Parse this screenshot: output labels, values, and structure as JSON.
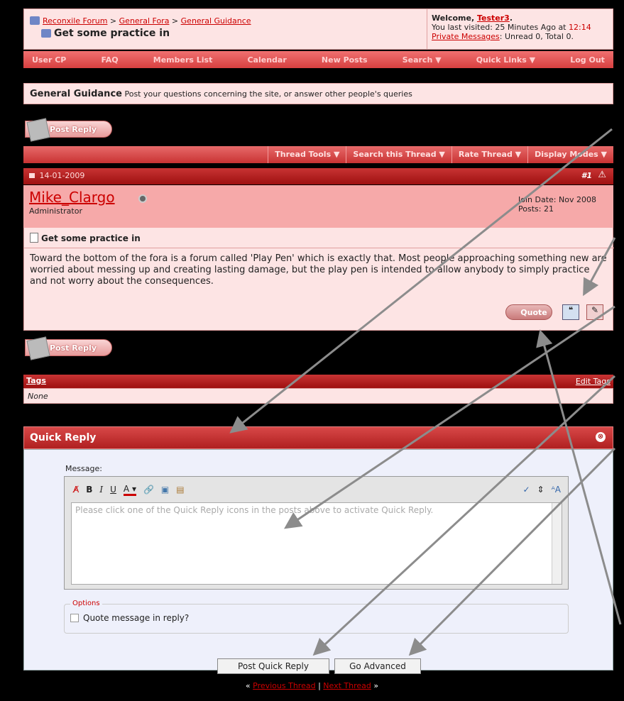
{
  "header": {
    "breadcrumb": [
      "Reconxile Forum",
      "General Fora",
      "General Guidance"
    ],
    "thread_title": "Get some practice in",
    "welcome_prefix": "Welcome, ",
    "username": "Tester3",
    "last_visited": "You last visited: 25 Minutes Ago at ",
    "last_time": "12:14",
    "pm_label": "Private Messages",
    "pm_counts": ": Unread 0, Total 0."
  },
  "navbar": [
    "User CP",
    "FAQ",
    "Members List",
    "Calendar",
    "New Posts",
    "Search ▼",
    "Quick Links ▼",
    "Log Out"
  ],
  "forum": {
    "name": "General Guidance",
    "description": "Post your questions concerning the site, or answer other people's queries"
  },
  "post_reply_label": "Post Reply",
  "thread_tools": [
    "Thread Tools ▼",
    "Search this Thread ▼",
    "Rate Thread ▼",
    "Display Modes ▼"
  ],
  "post": {
    "date": "14-01-2009",
    "number": "#1",
    "author": "Mike_Clargo",
    "role": "Administrator",
    "join_date": "Join Date: Nov 2008",
    "posts": "Posts: 21",
    "title": "Get some practice in",
    "body": "Toward the bottom of the fora is a forum called 'Play Pen' which is exactly that. Most people approaching something new are worried about messing up and creating lasting damage, but the play pen is intended to allow anybody to simply practice and not worry about the consequences.",
    "quote_label": "Quote"
  },
  "tags": {
    "heading": "Tags",
    "edit_label": "Edit Tags",
    "value": "None"
  },
  "quick_reply": {
    "heading": "Quick Reply",
    "message_label": "Message:",
    "placeholder": "Please click one of the Quick Reply icons in the posts above to activate Quick Reply.",
    "options_legend": "Options",
    "quote_option": "Quote message in reply?",
    "post_button": "Post Quick Reply",
    "advanced_button": "Go Advanced"
  },
  "thread_nav": {
    "previous": "Previous Thread",
    "separator": " | ",
    "next": "Next Thread"
  },
  "colors": {
    "accent_red": "#d84040",
    "dark_red": "#9e1010",
    "light_pink": "#fde4e4",
    "annotation_gray": "#8c8c8c"
  }
}
